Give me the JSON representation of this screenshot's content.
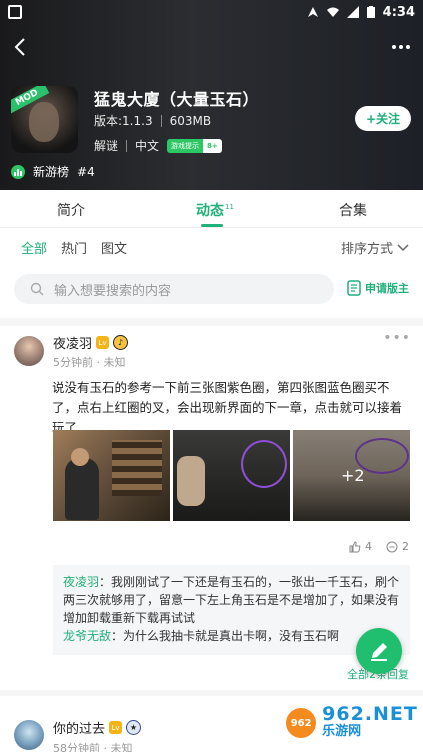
{
  "status_bar": {
    "time": "4:34"
  },
  "game": {
    "title": "猛鬼大廈（大量玉石）",
    "version": "版本:1.1.3",
    "size": "603MB",
    "genre": "解谜",
    "language": "中文",
    "mod_badge": "MOD",
    "hint_badge_left": "游戏提示",
    "hint_badge_right": "8+",
    "follow_label": "+关注",
    "rank_label": "新游榜",
    "rank_value": "#4"
  },
  "tabs": [
    {
      "label": "简介"
    },
    {
      "label": "动态",
      "count": "11"
    },
    {
      "label": "合集"
    }
  ],
  "filters": {
    "items": [
      "全部",
      "热门",
      "图文"
    ],
    "sort_label": "排序方式"
  },
  "search": {
    "placeholder": "输入想要搜索的内容",
    "apply_label": "申请版主"
  },
  "post1": {
    "author": "夜凌羽",
    "level": "Lv",
    "time": "5分钟前 · 未知",
    "text": "说没有玉石的参考一下前三张图紫色圈，第四张图蓝色圈买不了，点右上红圈的叉，会出现新界面的下一章，点击就可以接着玩了",
    "more_images": "+2",
    "likes": "4",
    "comments_count": "2",
    "comments": [
      {
        "name": "夜凌羽",
        "text": "：我刚刚试了一下还是有玉石的，一张出一千玉石，刷个两三次就够用了，留意一下左上角玉石是不是增加了，如果没有增加卸载重新下载再试试"
      },
      {
        "name": "龙爷无敌",
        "text": "：为什么我抽卡就是真出卡啊，没有玉石啊"
      }
    ],
    "all_replies": "全部2条回复"
  },
  "post2": {
    "author": "你的过去",
    "time": "58分钟前 · 未知"
  },
  "watermark": {
    "badge": "962",
    "main": "962.NET",
    "sub": "乐游网"
  }
}
